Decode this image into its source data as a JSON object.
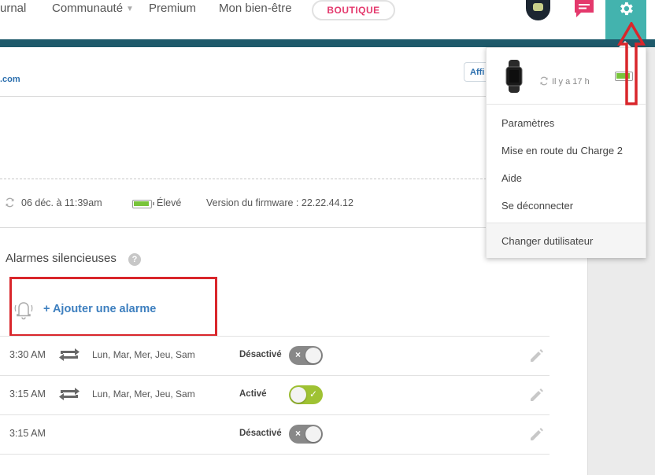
{
  "nav": {
    "journal": "urnal",
    "community": "Communauté",
    "premium": "Premium",
    "wellbeing": "Mon bien-être",
    "shop": "BOUTIQUE"
  },
  "account": {
    "email_fragment": ".com",
    "display_button": "Affi"
  },
  "device": {
    "last_sync": "06 déc. à 11:39am",
    "battery": "Élevé",
    "firmware": "Version du firmware : 22.22.44.12"
  },
  "alarms": {
    "title": "Alarmes silencieuses",
    "help": "?",
    "add_label": "+ Ajouter une alarme",
    "rows": [
      {
        "time": "3:30 AM",
        "days": "Lun, Mar, Mer, Jeu, Sam",
        "status": "Désactivé",
        "on": false,
        "mark": "×"
      },
      {
        "time": "3:15 AM",
        "days": "Lun, Mar, Mer, Jeu, Sam",
        "status": "Activé",
        "on": true,
        "mark": "✓"
      },
      {
        "time": "3:15 AM",
        "days": "",
        "status": "Désactivé",
        "on": false,
        "mark": "×"
      }
    ]
  },
  "dropdown": {
    "sync_ago": "Il y a 17 h",
    "items": [
      "Paramètres",
      "Mise en route du Charge 2",
      "Aide",
      "Se déconnecter"
    ],
    "footer": "Changer dutilisateur"
  },
  "colors": {
    "teal_bar": "#1f5a6b",
    "gear_bg": "#43b3ae",
    "shop_text": "#e4386c",
    "link_blue": "#3d7fbf",
    "annotation_red": "#d9262b",
    "toggle_on": "#9fc233"
  }
}
